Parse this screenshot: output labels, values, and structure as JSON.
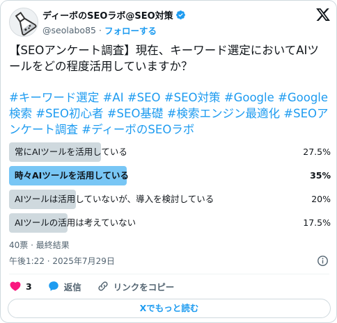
{
  "author": {
    "name": "ディーボのSEOラボ@SEO対策",
    "handle": "@seolabo85",
    "separator": "·",
    "follow_label": "フォローする",
    "avatar_icon": "flask-avatar-icon",
    "verified_icon": "verified-badge-icon",
    "verified_color": "#1d9bf0"
  },
  "platform_icon": "x-logo-icon",
  "tweet": {
    "text": "【SEOアンケート調査】現在、キーワード選定においてAIツールをどの程度活用していますか？",
    "hashtags": [
      "#キーワード選定",
      "#AI",
      "#SEO",
      "#SEO対策",
      "#Google",
      "#Google検索",
      "#SEO初心者",
      "#SEO基礎",
      "#検索エンジン最適化",
      "#SEOアンケート調査",
      "#ディーボのSEOラボ"
    ]
  },
  "poll": {
    "options": [
      {
        "label": "常にAIツールを活用している",
        "percent_text": "27.5%",
        "percent": 27.5,
        "winner": false
      },
      {
        "label": "時々AIツールを活用している",
        "percent_text": "35%",
        "percent": 35,
        "winner": true
      },
      {
        "label": "AIツールは活用していないが、導入を検討している",
        "percent_text": "20%",
        "percent": 20,
        "winner": false
      },
      {
        "label": "AIツールの活用は考えていない",
        "percent_text": "17.5%",
        "percent": 17.5,
        "winner": false
      }
    ],
    "meta": "40票 · 最終結果"
  },
  "timestamp": "午後1:22 · 2025年7月29日",
  "actions": {
    "like_count": "3",
    "reply_label": "返信",
    "copy_link_label": "リンクをコピー"
  },
  "more_button_label": "Xでもっと読む",
  "colors": {
    "accent": "#1d9bf0",
    "like": "#f91880",
    "poll_bar": "#cfd9de",
    "poll_bar_winner": "#78c6f5",
    "muted_text": "#536471"
  }
}
